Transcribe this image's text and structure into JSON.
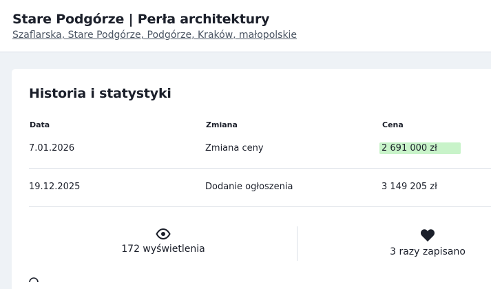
{
  "listing": {
    "title": "Stare Podgórze | Perła architektury",
    "address": "Szaflarska, Stare Podgórze, Podgórze, Kraków, małopolskie"
  },
  "history": {
    "title": "Historia i statystyki",
    "columns": {
      "date": "Data",
      "change": "Zmiana",
      "price": "Cena"
    },
    "rows": [
      {
        "date": "7.01.2026",
        "change": "Zmiana ceny",
        "price": "2 691 000 zł"
      },
      {
        "date": "19.12.2025",
        "change": "Dodanie ogłoszenia",
        "price": "3 149 205 zł"
      }
    ]
  },
  "stats": {
    "views": "172 wyświetlenia",
    "saves": "3 razy zapisano"
  },
  "colors": {
    "price_drop_highlight": "#c8f3c9",
    "page_bg": "#eef2f6"
  },
  "icons": {
    "views": "eye-icon",
    "saves": "heart-icon"
  }
}
